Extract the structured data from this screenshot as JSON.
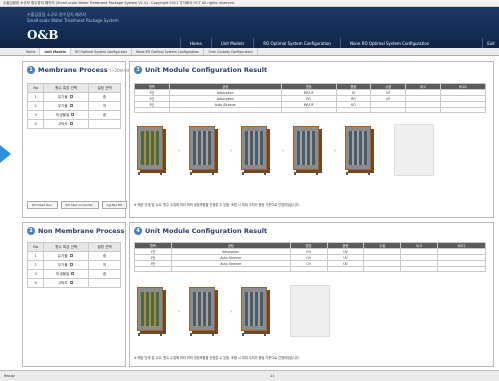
{
  "window": {
    "title": "수출입광장 소규모 정수장치 패키지 (Small-scale Water Treatment Package System V1.0) - Copyright 2011 주식회사 OCT All rights reserved."
  },
  "header": {
    "line1": "수출입광장 소규모 정수장치 패키지",
    "line2": "Small-scale Water Treatment Package System",
    "logo": "O&B"
  },
  "nav": {
    "items": [
      "Home",
      "Unit Models",
      "RO Optimal System Configuration",
      "None RO Optimal System Configuration"
    ],
    "exit": "Exit"
  },
  "tabs": [
    "Home",
    "Unit Models",
    "RO Optimal System Configurator",
    "None RO Optimal System Configuration",
    "Over Custody Configuration"
  ],
  "membrane": {
    "num": "1",
    "title": "Membrane Process",
    "unit": "(~20m³/d)",
    "headers": [
      "No",
      "원수 특성 선택",
      "설정 선택"
    ],
    "rows": [
      {
        "no": "1",
        "name": "유기물",
        "val": "중"
      },
      {
        "no": "2",
        "name": "무기물",
        "val": "저"
      },
      {
        "no": "3",
        "name": "미생물질",
        "val": "중"
      },
      {
        "no": "4",
        "name": "고탁도",
        "val": ""
      }
    ],
    "buttons": [
      "RO Head Rev.",
      "RO Skid model No.",
      "Agrfter RO"
    ]
  },
  "nonmembrane": {
    "num": "2",
    "title": "Non Membrane Process",
    "headers": [
      "No",
      "원수 특성 선택",
      "설정 선택"
    ],
    "rows": [
      {
        "no": "1",
        "name": "유기물",
        "val": "중"
      },
      {
        "no": "2",
        "name": "무기물",
        "val": "저"
      },
      {
        "no": "3",
        "name": "미생물질",
        "val": "중"
      },
      {
        "no": "4",
        "name": "고탁도",
        "val": ""
      }
    ]
  },
  "result1": {
    "num": "3",
    "title": "Unit Module Configuration Result",
    "headers": [
      "항목",
      "공정",
      "명칭",
      "용량",
      "수량",
      "비고",
      "비고2"
    ],
    "rows": [
      [
        "1단",
        "Adsorption",
        "MF/UF",
        "IO",
        "UF",
        ""
      ],
      [
        "2단",
        "Adsorption",
        "RO",
        "RO",
        "UF",
        ""
      ],
      [
        "3단",
        "Auto Strainer",
        "MF/UF",
        "UO",
        "",
        ""
      ]
    ],
    "note": "※ 해당 단계 및 수요, 원수 수질에 따라 최적 공정조합을 선정할 수 있음. 조합 시 최대 수처리 용량 기준으로 선정되었습니다."
  },
  "result2": {
    "num": "4",
    "title": "Unit Module Configuration Result",
    "headers": [
      "항목",
      "공정",
      "명칭",
      "용량",
      "수량",
      "비고",
      "비고2"
    ],
    "rows": [
      [
        "1단",
        "Adsorption",
        "CH",
        "UV",
        ""
      ],
      [
        "2단",
        "Auto Strainer",
        "CH",
        "UV",
        ""
      ],
      [
        "3단",
        "Auto Strainer",
        "CH",
        "UV",
        ""
      ]
    ],
    "note": "※ 해당 단계 및 수요, 원수 수질에 따라 최적 공정조합을 선정할 수 있음. 조합 시 최대 수처리 용량 기준으로 선정되었습니다."
  },
  "status": {
    "left": "Ready",
    "mid": "11"
  }
}
